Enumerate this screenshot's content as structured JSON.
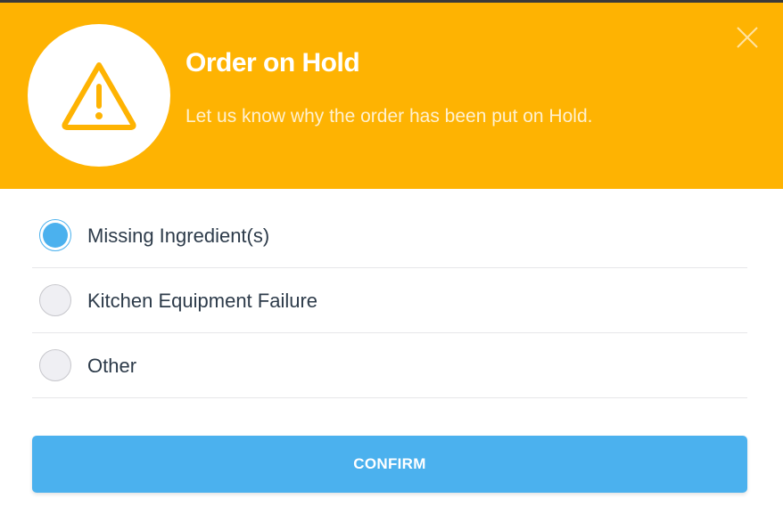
{
  "header": {
    "title": "Order on Hold",
    "subtitle": "Let us know why the order has been put on Hold.",
    "icon": "warning-triangle-icon",
    "close_icon": "close-icon",
    "color": "#FEB302"
  },
  "options": [
    {
      "label": "Missing Ingredient(s)",
      "selected": true
    },
    {
      "label": "Kitchen Equipment Failure",
      "selected": false
    },
    {
      "label": "Other",
      "selected": false
    }
  ],
  "confirm_label": "CONFIRM",
  "accent_color": "#4BB1EE"
}
